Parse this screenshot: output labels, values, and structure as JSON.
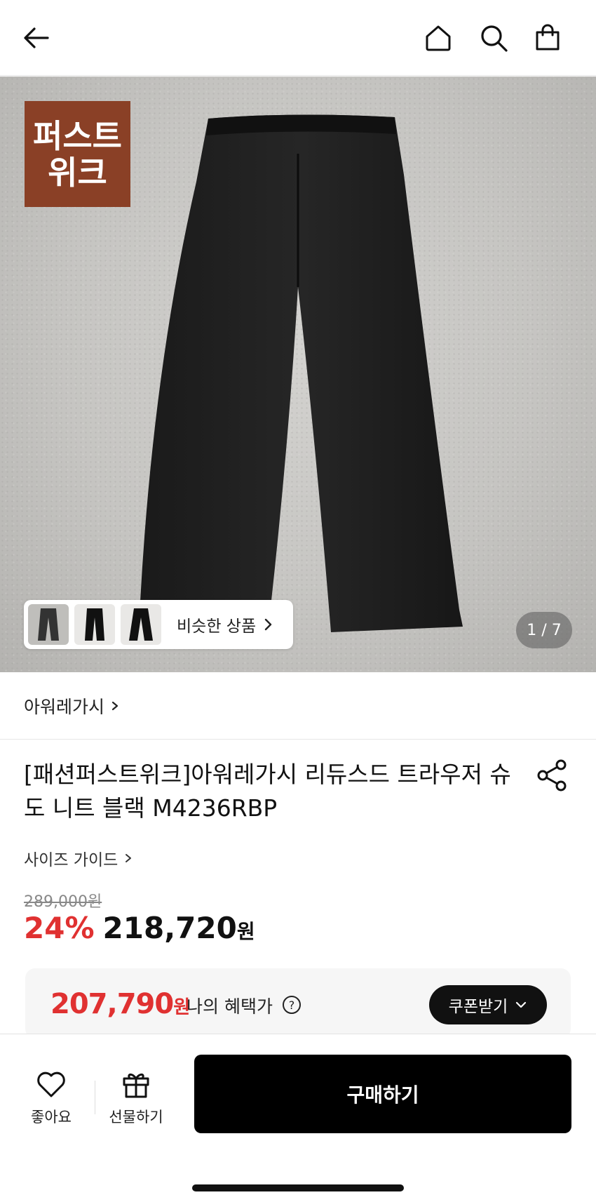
{
  "header": {
    "back_icon": "arrow-left-icon",
    "home_icon": "home-icon",
    "search_icon": "search-icon",
    "bag_icon": "shopping-bag-icon"
  },
  "gallery": {
    "badge_line1": "퍼스트",
    "badge_line2": "위크",
    "badge_color": "#8a4026",
    "similar_label": "비슷한 상품",
    "counter": "1 / 7"
  },
  "brand": {
    "name": "아워레가시"
  },
  "product": {
    "title": "[패션퍼스트위크]아워레가시 리듀스드 트라우저 슈도 니트 블랙 M4236RBP",
    "size_guide": "사이즈 가이드",
    "original_price": "289,000원",
    "discount": "24%",
    "sale_price": "218,720",
    "sale_unit": "원"
  },
  "benefit": {
    "price": "207,790",
    "unit": "원",
    "label": "나의 혜택가",
    "coupon_button": "쿠폰받기"
  },
  "bottom_bar": {
    "like_label": "좋아요",
    "gift_label": "선물하기",
    "buy_label": "구매하기"
  },
  "colors": {
    "accent_red": "#e03131",
    "buy_button": "#000000"
  }
}
